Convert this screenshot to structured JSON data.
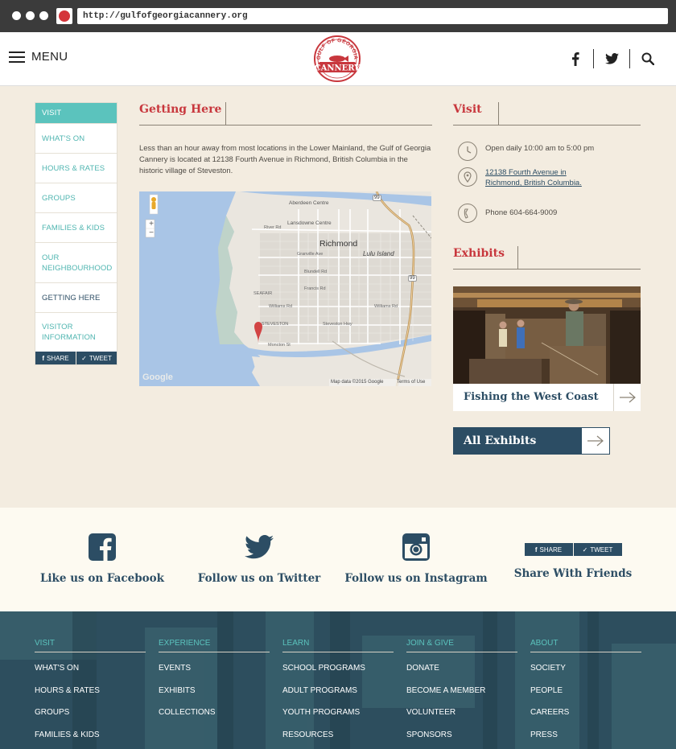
{
  "browser": {
    "url": "http://gulfofgeorgiacannery.org"
  },
  "header": {
    "menu_label": "MENU",
    "logo_text_top": "GULF OF GEORGIA",
    "logo_text_main": "CANNERY",
    "icons": [
      "facebook-icon",
      "twitter-icon",
      "search-icon"
    ]
  },
  "sidebar": {
    "items": [
      {
        "label": "VISIT",
        "state": "active"
      },
      {
        "label": "WHAT'S ON",
        "state": "normal"
      },
      {
        "label": "HOURS & RATES",
        "state": "normal"
      },
      {
        "label": "GROUPS",
        "state": "normal"
      },
      {
        "label": "FAMILIES & KIDS",
        "state": "normal"
      },
      {
        "label": "OUR NEIGHBOURHOOD",
        "state": "normal"
      },
      {
        "label": "GETTING HERE",
        "state": "current"
      },
      {
        "label": "VISITOR INFORMATION",
        "state": "normal"
      }
    ],
    "share_label": "SHARE",
    "tweet_label": "TWEET"
  },
  "main": {
    "heading": "Getting Here",
    "body": "Less than an hour away from most locations in the Lower Mainland, the Gulf of Georgia Cannery is located at 12138 Fourth Avenue in Richmond, British Columbia in the historic village of Steveston."
  },
  "map": {
    "city": "Richmond",
    "island": "Lulu Island",
    "places": [
      "Aberdeen Centre",
      "Lansdowne Centre",
      "River Rd",
      "Granville Ave",
      "Blundell Rd",
      "Francis Rd",
      "Williams Rd",
      "Steveston Hwy",
      "Moncton St",
      "SEAFAIR",
      "STEVESTON",
      "No 2 Rd",
      "No 3 Rd",
      "No 4 Rd",
      "No 5 Rd",
      "Railway Ave",
      "Gilbert Rd",
      "Garden City Rd",
      "Williams Rd",
      "Steveston Hwy"
    ],
    "highways": [
      "99",
      "99"
    ],
    "zoom_in": "+",
    "zoom_out": "−",
    "google_label": "Google",
    "attribution": "Map data ©2015 Google",
    "terms": "Terms of Use"
  },
  "visit": {
    "heading": "Visit",
    "hours": "Open daily 10:00 am to 5:00 pm",
    "address_line1": "12138 Fourth Avenue in",
    "address_line2": "Richmond, British Columbia.",
    "phone": "Phone 604-664-9009"
  },
  "exhibits": {
    "heading": "Exhibits",
    "feature_label": "Fishing the West Coast",
    "all_label": "All Exhibits"
  },
  "social": {
    "facebook": "Like us on Facebook",
    "twitter": "Follow us on Twitter",
    "instagram": "Follow us on Instagram",
    "share": "Share With Friends",
    "share_btn": "SHARE",
    "tweet_btn": "TWEET"
  },
  "footer": {
    "columns": [
      {
        "head": "VISIT",
        "links": [
          "WHAT'S ON",
          "HOURS & RATES",
          "GROUPS",
          "FAMILIES & KIDS"
        ]
      },
      {
        "head": "EXPERIENCE",
        "links": [
          "EVENTS",
          "EXHIBITS",
          "COLLECTIONS"
        ]
      },
      {
        "head": "LEARN",
        "links": [
          "SCHOOL PROGRAMS",
          "ADULT PROGRAMS",
          "YOUTH PROGRAMS",
          "RESOURCES"
        ]
      },
      {
        "head": "JOIN & GIVE",
        "links": [
          "DONATE",
          "BECOME A MEMBER",
          "VOLUNTEER",
          "SPONSORS"
        ]
      },
      {
        "head": "ABOUT",
        "links": [
          "SOCIETY",
          "PEOPLE",
          "CAREERS",
          "PRESS"
        ]
      }
    ]
  },
  "colors": {
    "brand_red": "#c8373d",
    "brand_navy": "#2c4d64",
    "brand_teal": "#5bc3bd",
    "page_bg": "#f3ece0"
  }
}
